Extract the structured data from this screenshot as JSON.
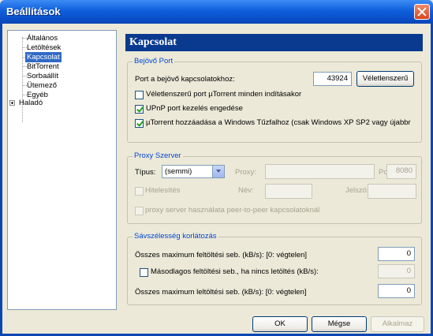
{
  "window": {
    "title": "Beállítások"
  },
  "sidebar": {
    "items": [
      {
        "label": "Általános"
      },
      {
        "label": "Letöltések"
      },
      {
        "label": "Kapcsolat"
      },
      {
        "label": "BitTorrent"
      },
      {
        "label": "Sorbaállít"
      },
      {
        "label": "Ütemező"
      },
      {
        "label": "Egyéb"
      },
      {
        "label": "Haladó"
      }
    ],
    "selected": "Kapcsolat"
  },
  "page": {
    "title": "Kapcsolat"
  },
  "incoming": {
    "title": "Bejövő Port",
    "port_label": "Port a bejövő kapcsolatokhoz:",
    "port_value": "43924",
    "random_button": "Véletlenszerű",
    "random_each_start": "Véletlenszerű port µTorrent minden indításakor",
    "upnp": "UPnP port kezelés engedése",
    "firewall": "µTorrent hozzáadása a Windows Tűzfalhoz (csak Windows XP SP2 vagy újabbr"
  },
  "proxy": {
    "title": "Proxy Szerver",
    "type_label": "Típus:",
    "type_value": "(semmi)",
    "proxy_label": "Proxy:",
    "port_label": "Port:",
    "port_value": "8080",
    "auth_label": "Hitelesítés",
    "user_label": "Név:",
    "pass_label": "Jelszó:",
    "p2p_label": "proxy server használata peer-to-peer kapcsolatoknál"
  },
  "bandwidth": {
    "title": "Sávszélesség korlátozás",
    "max_upload_label": "Összes maximum feltöltési seb. (kB/s): [0: végtelen]",
    "max_upload_value": "0",
    "alt_upload_label": "Másodlagos feltöltési seb., ha nincs letöltés (kB/s):",
    "alt_upload_value": "0",
    "max_download_label": "Összes maximum leltöltési seb. (kB/s): [0: végtelen]",
    "max_download_value": "0"
  },
  "footer": {
    "ok": "OK",
    "cancel": "Mégse",
    "apply": "Alkalmaz"
  }
}
